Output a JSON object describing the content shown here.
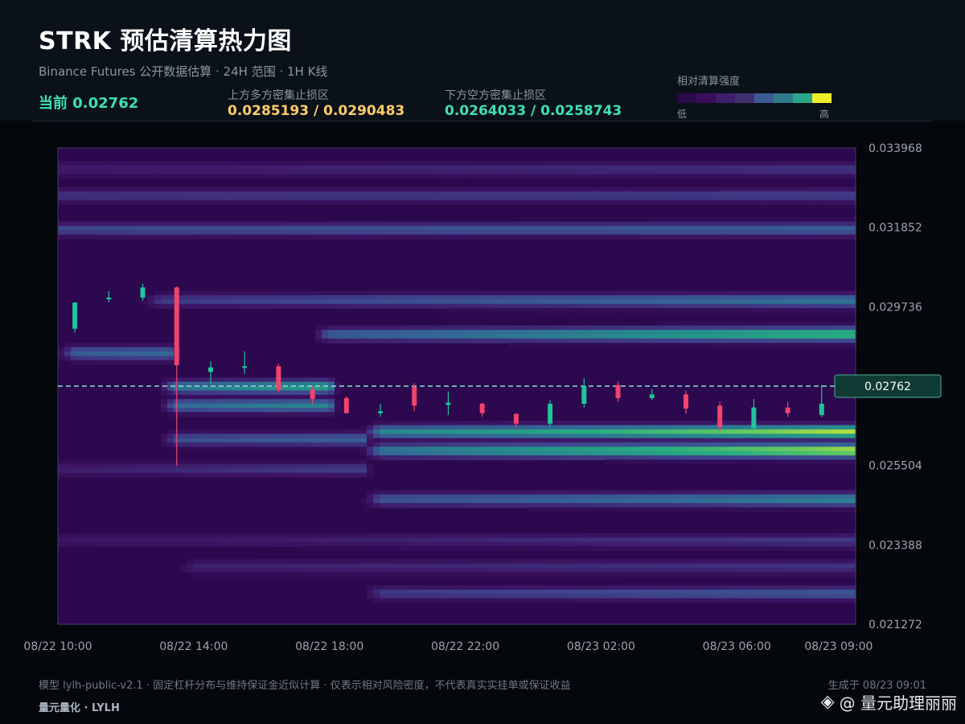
{
  "header": {
    "title": "STRK 预估清算热力图",
    "subtitle": "Binance Futures 公开数据估算  ·  24H 范围  ·  1H K线",
    "current_label": "当前 0.02762",
    "upper_zone_label": "上方多方密集止损区",
    "upper_zone_value": "0.0285193 / 0.0290483",
    "lower_zone_label": "下方空方密集止损区",
    "lower_zone_value": "0.0264033 / 0.0258743",
    "legend_title": "相对清算强度",
    "legend_low": "低",
    "legend_high": "高"
  },
  "colors": {
    "upper_zone": "#ffcc66",
    "lower_zone": "#3fe0b0",
    "candle_up": "#1fc59a",
    "candle_down": "#f0446e",
    "current_line": "#8fe3d2",
    "legend_steps": [
      "#2b0a4a",
      "#3a0e5c",
      "#3b1f6b",
      "#41306f",
      "#3c5a95",
      "#2f7a8a",
      "#2aa78a",
      "#f0ee2a"
    ]
  },
  "footer": {
    "note": "模型 lylh-public-v2.1  ·  固定杠杆分布与维持保证金近似计算  ·  仅表示相对风险密度，不代表真实实挂单或保证收益",
    "brand": "量元量化  ·  LYLH",
    "generated": "生成于 08/23 09:01",
    "watermark_icon": "binance-diamond-icon",
    "watermark_text": "@ 量元助理丽丽",
    "watermark_glyph": "◈"
  },
  "chart_data": {
    "type": "heatmap",
    "title": "STRK 预估清算热力图",
    "x_labels": [
      "08/22 10:00",
      "08/22 14:00",
      "08/22 18:00",
      "08/22 22:00",
      "08/23 02:00",
      "08/23 06:00",
      "08/23 09:00"
    ],
    "x_label_hours": [
      0,
      4,
      8,
      12,
      16,
      20,
      23
    ],
    "x_range_hours": [
      0,
      23.5
    ],
    "y_ticks": [
      0.033968,
      0.031852,
      0.029736,
      0.02762,
      0.025504,
      0.023388,
      0.021272
    ],
    "y_tick_labels": [
      "0.033968",
      "0.031852",
      "0.029736",
      "0.02762",
      "0.025504",
      "0.023388",
      "0.021272"
    ],
    "ylim": [
      0.021272,
      0.033968
    ],
    "current_price": 0.02762,
    "current_price_label": "0.02762",
    "heat_bands": [
      {
        "price": 0.0334,
        "start_hour": 0,
        "end_hour": 23.5,
        "intensity_start": 0.2,
        "intensity_end": 0.28
      },
      {
        "price": 0.0327,
        "start_hour": 0,
        "end_hour": 23.5,
        "intensity_start": 0.28,
        "intensity_end": 0.32
      },
      {
        "price": 0.0318,
        "start_hour": 0,
        "end_hour": 23.5,
        "intensity_start": 0.35,
        "intensity_end": 0.45
      },
      {
        "price": 0.0299,
        "start_hour": 3,
        "end_hour": 23.5,
        "intensity_start": 0.3,
        "intensity_end": 0.55
      },
      {
        "price": 0.029,
        "start_hour": 8,
        "end_hour": 23.5,
        "intensity_start": 0.45,
        "intensity_end": 0.82
      },
      {
        "price": 0.0285,
        "start_hour": 0.5,
        "end_hour": 3.3,
        "intensity_start": 0.45,
        "intensity_end": 0.5
      },
      {
        "price": 0.0276,
        "start_hour": 3.5,
        "end_hour": 8,
        "intensity_start": 0.55,
        "intensity_end": 0.7
      },
      {
        "price": 0.0271,
        "start_hour": 3.5,
        "end_hour": 8,
        "intensity_start": 0.5,
        "intensity_end": 0.6
      },
      {
        "price": 0.0264,
        "start_hour": 9.5,
        "end_hour": 23.5,
        "intensity_start": 0.6,
        "intensity_end": 0.95
      },
      {
        "price": 0.0259,
        "start_hour": 9.5,
        "end_hour": 23.5,
        "intensity_start": 0.55,
        "intensity_end": 0.98
      },
      {
        "price": 0.0262,
        "start_hour": 3.5,
        "end_hour": 9,
        "intensity_start": 0.38,
        "intensity_end": 0.45
      },
      {
        "price": 0.0254,
        "start_hour": 0,
        "end_hour": 9,
        "intensity_start": 0.2,
        "intensity_end": 0.32
      },
      {
        "price": 0.0246,
        "start_hour": 9.5,
        "end_hour": 23.5,
        "intensity_start": 0.4,
        "intensity_end": 0.6
      },
      {
        "price": 0.0235,
        "start_hour": 0,
        "end_hour": 23.5,
        "intensity_start": 0.16,
        "intensity_end": 0.3
      },
      {
        "price": 0.0228,
        "start_hour": 4,
        "end_hour": 23.5,
        "intensity_start": 0.22,
        "intensity_end": 0.28
      },
      {
        "price": 0.0221,
        "start_hour": 9.5,
        "end_hour": 23.5,
        "intensity_start": 0.3,
        "intensity_end": 0.42
      }
    ],
    "candles": [
      {
        "hour": 0.5,
        "open": 0.02915,
        "high": 0.02985,
        "low": 0.02905,
        "close": 0.02985
      },
      {
        "hour": 1.5,
        "open": 0.02995,
        "high": 0.03015,
        "low": 0.02985,
        "close": 0.02998
      },
      {
        "hour": 2.5,
        "open": 0.02998,
        "high": 0.03035,
        "low": 0.0299,
        "close": 0.03025
      },
      {
        "hour": 3.5,
        "open": 0.03025,
        "high": 0.03028,
        "low": 0.0255,
        "close": 0.02818
      },
      {
        "hour": 4.5,
        "open": 0.028,
        "high": 0.02828,
        "low": 0.0277,
        "close": 0.02812
      },
      {
        "hour": 5.5,
        "open": 0.02812,
        "high": 0.02855,
        "low": 0.02795,
        "close": 0.02815
      },
      {
        "hour": 6.5,
        "open": 0.02815,
        "high": 0.02822,
        "low": 0.02745,
        "close": 0.02752
      },
      {
        "hour": 7.5,
        "open": 0.02752,
        "high": 0.02762,
        "low": 0.02715,
        "close": 0.02728
      },
      {
        "hour": 8.5,
        "open": 0.0273,
        "high": 0.02735,
        "low": 0.0269,
        "close": 0.0269
      },
      {
        "hour": 9.5,
        "open": 0.0269,
        "high": 0.02715,
        "low": 0.0268,
        "close": 0.02695
      },
      {
        "hour": 10.5,
        "open": 0.0276,
        "high": 0.0277,
        "low": 0.02695,
        "close": 0.0271
      },
      {
        "hour": 11.5,
        "open": 0.02712,
        "high": 0.02748,
        "low": 0.02685,
        "close": 0.02718
      },
      {
        "hour": 12.5,
        "open": 0.02715,
        "high": 0.02718,
        "low": 0.0268,
        "close": 0.0269
      },
      {
        "hour": 13.5,
        "open": 0.02688,
        "high": 0.0269,
        "low": 0.02652,
        "close": 0.02662
      },
      {
        "hour": 14.5,
        "open": 0.02662,
        "high": 0.02725,
        "low": 0.02655,
        "close": 0.02715
      },
      {
        "hour": 15.5,
        "open": 0.02715,
        "high": 0.02783,
        "low": 0.02705,
        "close": 0.02762
      },
      {
        "hour": 16.5,
        "open": 0.02765,
        "high": 0.02775,
        "low": 0.0272,
        "close": 0.0273
      },
      {
        "hour": 17.5,
        "open": 0.0273,
        "high": 0.02755,
        "low": 0.02725,
        "close": 0.0274
      },
      {
        "hour": 18.5,
        "open": 0.0274,
        "high": 0.0275,
        "low": 0.02688,
        "close": 0.02702
      },
      {
        "hour": 19.5,
        "open": 0.0271,
        "high": 0.0272,
        "low": 0.02638,
        "close": 0.02652
      },
      {
        "hour": 20.5,
        "open": 0.0265,
        "high": 0.02728,
        "low": 0.02642,
        "close": 0.02705
      },
      {
        "hour": 21.5,
        "open": 0.02705,
        "high": 0.0272,
        "low": 0.0268,
        "close": 0.0269
      },
      {
        "hour": 22.5,
        "open": 0.02685,
        "high": 0.02765,
        "low": 0.0268,
        "close": 0.02715
      }
    ]
  }
}
